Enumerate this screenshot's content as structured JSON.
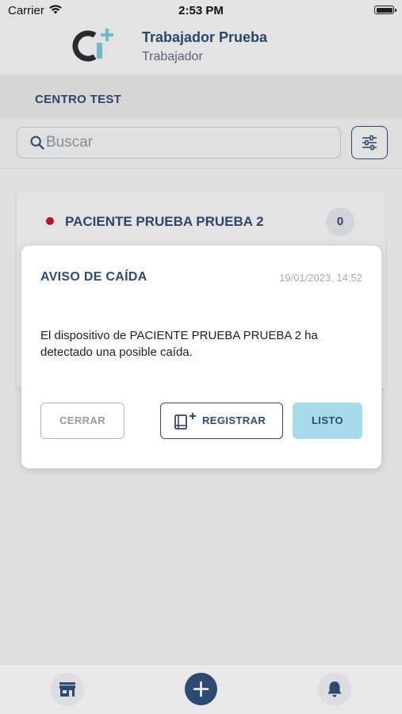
{
  "status_bar": {
    "carrier": "Carrier",
    "time": "2:53 PM"
  },
  "header": {
    "user_name": "Trabajador Prueba",
    "user_role": "Trabajador"
  },
  "center": {
    "name": "CENTRO TEST"
  },
  "search": {
    "placeholder": "Buscar",
    "value": ""
  },
  "patient_card": {
    "name": "PACIENTE PRUEBA PRUEBA 2",
    "count": "0",
    "status_color": "#c0171e"
  },
  "modal": {
    "title": "AVISO DE CAÍDA",
    "date": "19/01/2023, 14:52",
    "message": "El dispositivo de PACIENTE PRUEBA PRUEBA 2 ha detectado una posible caída.",
    "buttons": {
      "close": "CERRAR",
      "register": "REGISTRAR",
      "done": "LISTO"
    }
  },
  "bottom_nav": {
    "icons": [
      "store-icon",
      "plus-icon",
      "bell-icon"
    ]
  },
  "colors": {
    "primary": "#2f4a72",
    "accent": "#a8dbe9",
    "logo_accent": "#7cc4d8",
    "alert": "#c0171e"
  }
}
